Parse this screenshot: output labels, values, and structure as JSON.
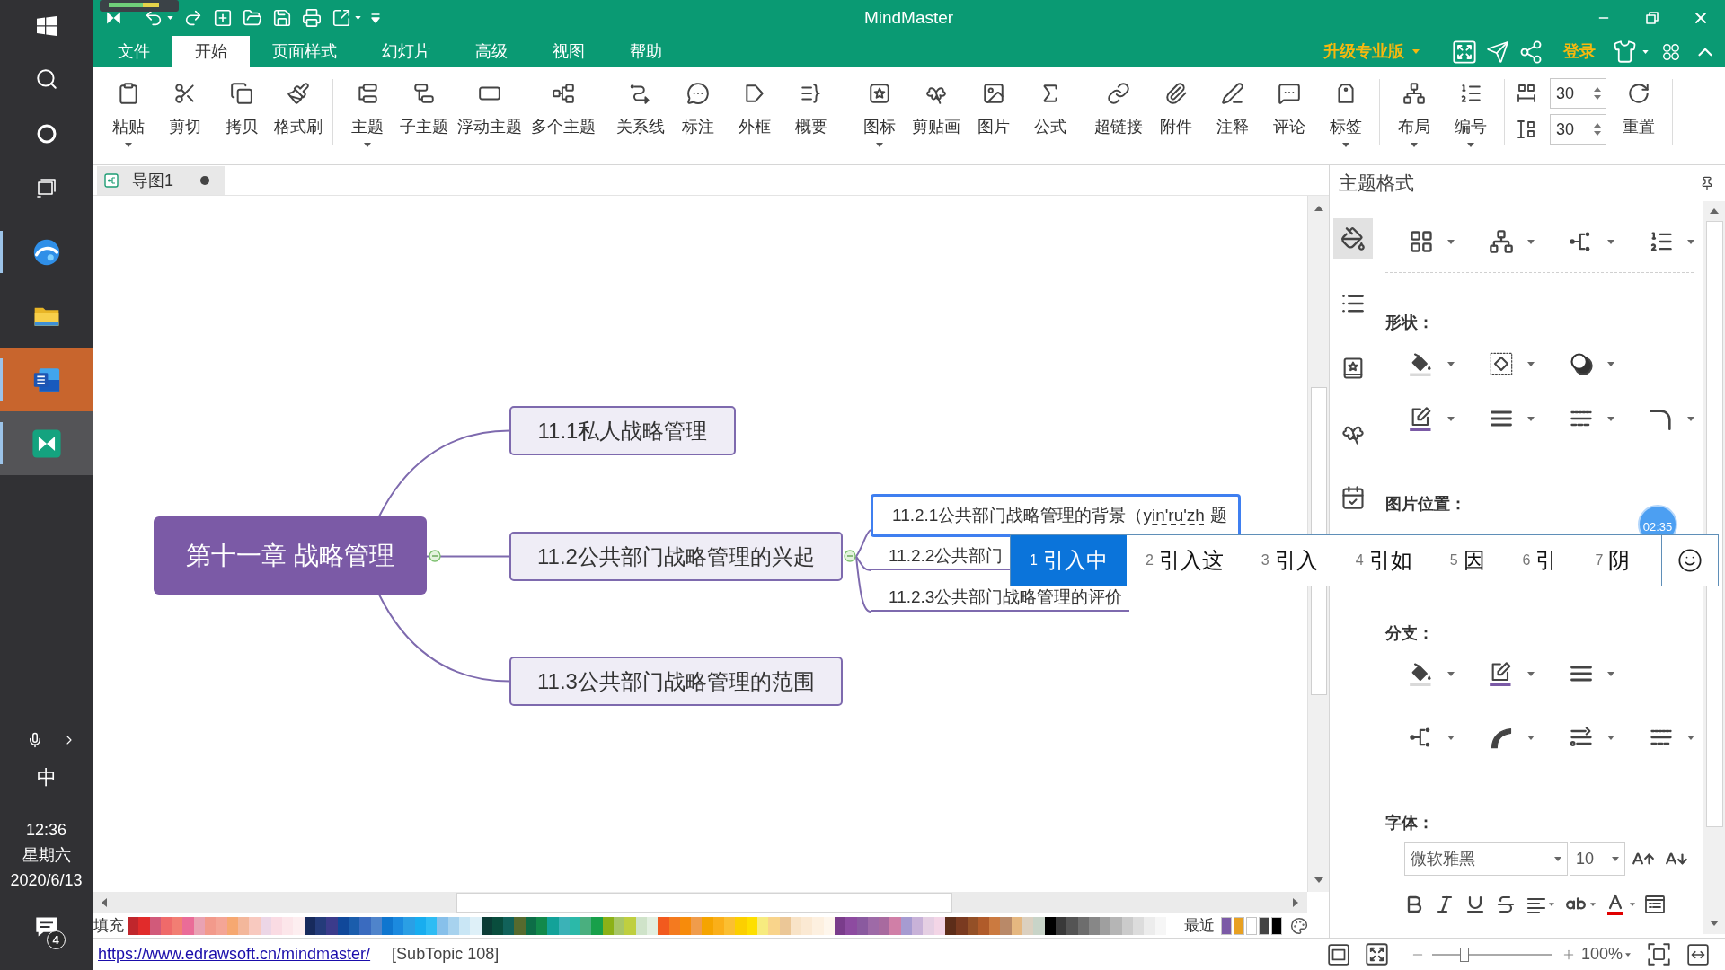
{
  "taskbar": {
    "apps": [
      {
        "kind": "browser",
        "running": true,
        "attention": false,
        "selected": false
      },
      {
        "kind": "folder",
        "running": false,
        "attention": false,
        "selected": false
      },
      {
        "kind": "word",
        "running": true,
        "attention": true,
        "selected": false
      },
      {
        "kind": "mindmaster",
        "running": true,
        "attention": false,
        "selected": true
      }
    ],
    "input_method": "中",
    "clock": {
      "time": "12:36",
      "weekday": "星期六",
      "date": "2020/6/13"
    },
    "notifications": {
      "count": "4"
    }
  },
  "window": {
    "title": "MindMaster"
  },
  "menu_tabs": [
    {
      "label": "文件",
      "selected": false
    },
    {
      "label": "开始",
      "selected": true
    },
    {
      "label": "页面样式",
      "selected": false
    },
    {
      "label": "幻灯片",
      "selected": false
    },
    {
      "label": "高级",
      "selected": false
    },
    {
      "label": "视图",
      "selected": false
    },
    {
      "label": "帮助",
      "selected": false
    }
  ],
  "upgrade_button": {
    "label": "升级专业版"
  },
  "login_link": {
    "label": "登录"
  },
  "ribbon": {
    "groups": [
      [
        {
          "label": "粘贴",
          "dropdown": true
        },
        {
          "label": "剪切",
          "dropdown": false
        },
        {
          "label": "拷贝",
          "dropdown": false
        },
        {
          "label": "格式刷",
          "dropdown": false
        }
      ],
      [
        {
          "label": "主题",
          "dropdown": true
        },
        {
          "label": "子主题",
          "dropdown": false
        },
        {
          "label": "浮动主题",
          "dropdown": false
        },
        {
          "label": "多个主题",
          "dropdown": false
        }
      ],
      [
        {
          "label": "关系线",
          "dropdown": false
        },
        {
          "label": "标注",
          "dropdown": false
        },
        {
          "label": "外框",
          "dropdown": false
        },
        {
          "label": "概要",
          "dropdown": false
        }
      ],
      [
        {
          "label": "图标",
          "dropdown": true
        },
        {
          "label": "剪贴画",
          "dropdown": false
        },
        {
          "label": "图片",
          "dropdown": false
        },
        {
          "label": "公式",
          "dropdown": false
        }
      ],
      [
        {
          "label": "超链接",
          "dropdown": false
        },
        {
          "label": "附件",
          "dropdown": false
        },
        {
          "label": "注释",
          "dropdown": false
        },
        {
          "label": "评论",
          "dropdown": false
        },
        {
          "label": "标签",
          "dropdown": true
        }
      ],
      [
        {
          "label": "布局",
          "dropdown": true
        },
        {
          "label": "编号",
          "dropdown": true
        }
      ]
    ],
    "spacing": [
      {
        "value": "30"
      },
      {
        "value": "30"
      }
    ],
    "reset": {
      "label": "重置"
    }
  },
  "document_tabs": [
    {
      "label": "导图1",
      "modified": true,
      "selected": true
    }
  ],
  "mind_map": {
    "central": {
      "label": "第十一章 战略管理"
    },
    "topics": [
      {
        "label": "11.1私人战略管理"
      },
      {
        "label": "11.2公共部门战略管理的兴起",
        "children": [
          {
            "label": "11.2.1公共部门战略管理的背景（",
            "composition": "yin'ru'zh",
            "trailing": "题",
            "selected": true
          },
          {
            "label": "11.2.2公共部门",
            "selected": false
          },
          {
            "label": "11.2.3公共部门战略管理的评价",
            "selected": false
          }
        ]
      },
      {
        "label": "11.3公共部门战略管理的范围"
      }
    ]
  },
  "ime": {
    "candidates": [
      {
        "number": "1",
        "text": "引入中",
        "selected": true
      },
      {
        "number": "2",
        "text": "引入这",
        "selected": false
      },
      {
        "number": "3",
        "text": "引入",
        "selected": false
      },
      {
        "number": "4",
        "text": "引如",
        "selected": false
      },
      {
        "number": "5",
        "text": "因",
        "selected": false
      },
      {
        "number": "6",
        "text": "引",
        "selected": false
      },
      {
        "number": "7",
        "text": "阴",
        "selected": false
      }
    ]
  },
  "timer": {
    "label": "02:35"
  },
  "format_panel": {
    "title": "主题格式",
    "side_tabs": [
      {
        "selected": true
      },
      {
        "selected": false
      },
      {
        "selected": false
      },
      {
        "selected": false
      },
      {
        "selected": false
      }
    ],
    "shape_label": "形状：",
    "image_position_label": "图片位置：",
    "branch_label": "分支：",
    "font_label": "字体：",
    "font_family": "微软雅黑",
    "font_size": "10"
  },
  "palette": {
    "label": "填充",
    "swatches": [
      {
        "color": "#c0262c"
      },
      {
        "color": "#e12b2b"
      },
      {
        "color": "#d15a7a"
      },
      {
        "color": "#ef6a6a"
      },
      {
        "color": "#f27e73"
      },
      {
        "color": "#ea6c98"
      },
      {
        "color": "#e9a2b3"
      },
      {
        "color": "#f29a8b"
      },
      {
        "color": "#f4a596"
      },
      {
        "color": "#f6a871"
      },
      {
        "color": "#f3b79b"
      },
      {
        "color": "#f8c9bf"
      },
      {
        "color": "#ecd6e6"
      },
      {
        "color": "#fadbe3"
      },
      {
        "color": "#fce6ea"
      },
      {
        "color": "#fdeef0"
      },
      {
        "color": "#172a5c"
      },
      {
        "color": "#243b7a"
      },
      {
        "color": "#3b3b8b"
      },
      {
        "color": "#10489a"
      },
      {
        "color": "#1b5dac"
      },
      {
        "color": "#3a6bbf"
      },
      {
        "color": "#4f84cb"
      },
      {
        "color": "#0f76cf"
      },
      {
        "color": "#1b8adf"
      },
      {
        "color": "#2a9fe5"
      },
      {
        "color": "#18adef"
      },
      {
        "color": "#2ebcf4"
      },
      {
        "color": "#87c0ea"
      },
      {
        "color": "#a7d2ee"
      },
      {
        "color": "#c9e6f5"
      },
      {
        "color": "#def0f8"
      },
      {
        "color": "#0b3c36"
      },
      {
        "color": "#094d3d"
      },
      {
        "color": "#11625a"
      },
      {
        "color": "#566a2e"
      },
      {
        "color": "#0d6d47"
      },
      {
        "color": "#12894a"
      },
      {
        "color": "#13a299"
      },
      {
        "color": "#3bb2b7"
      },
      {
        "color": "#2bb9a9"
      },
      {
        "color": "#4aaf7f"
      },
      {
        "color": "#18a04a"
      },
      {
        "color": "#8cb117"
      },
      {
        "color": "#a7c666"
      },
      {
        "color": "#bfcf3f"
      },
      {
        "color": "#cfe3c9"
      },
      {
        "color": "#e2efe0"
      },
      {
        "color": "#f25a1e"
      },
      {
        "color": "#f47a1f"
      },
      {
        "color": "#f78b0b"
      },
      {
        "color": "#f09c4b"
      },
      {
        "color": "#f5a400"
      },
      {
        "color": "#faaf19"
      },
      {
        "color": "#fbbf31"
      },
      {
        "color": "#fccf00"
      },
      {
        "color": "#fedf00"
      },
      {
        "color": "#f7eb7f"
      },
      {
        "color": "#f9d48b"
      },
      {
        "color": "#ebc797"
      },
      {
        "color": "#f8e3c7"
      },
      {
        "color": "#fbe9d3"
      },
      {
        "color": "#fdf0e0"
      },
      {
        "color": "#fef6ec"
      },
      {
        "color": "#7a3c8b"
      },
      {
        "color": "#8d4ba0"
      },
      {
        "color": "#8a5a9f"
      },
      {
        "color": "#9e6aa7"
      },
      {
        "color": "#a86a9f"
      },
      {
        "color": "#d07fa7"
      },
      {
        "color": "#a69bd1"
      },
      {
        "color": "#c8b2d8"
      },
      {
        "color": "#e5cfe3"
      },
      {
        "color": "#f3d5e6"
      },
      {
        "color": "#5d2d19"
      },
      {
        "color": "#7a3a20"
      },
      {
        "color": "#945027"
      },
      {
        "color": "#b05b2a"
      },
      {
        "color": "#cb7a40"
      },
      {
        "color": "#b98968"
      },
      {
        "color": "#e5b780"
      },
      {
        "color": "#dbd0c0"
      },
      {
        "color": "#c8d4c8"
      },
      {
        "color": "#000000"
      },
      {
        "color": "#393939"
      },
      {
        "color": "#545454"
      },
      {
        "color": "#6d6d6d"
      },
      {
        "color": "#878787"
      },
      {
        "color": "#9f9f9f"
      },
      {
        "color": "#b5b5b5"
      },
      {
        "color": "#cbcbcb"
      },
      {
        "color": "#dcdcdc"
      },
      {
        "color": "#ececec"
      },
      {
        "color": "#f6f6f6"
      }
    ],
    "recent_label": "最近",
    "recent": [
      {
        "color": "#7b5aa6"
      },
      {
        "color": "#e8a020"
      },
      {
        "color": "#ffffff"
      },
      {
        "color": "#444444"
      },
      {
        "color": "#000000"
      }
    ]
  },
  "status_bar": {
    "link": "https://www.edrawsoft.cn/mindmaster/",
    "selection": "[SubTopic 108]",
    "zoom": {
      "level": 0.27,
      "reading": "100%"
    }
  }
}
